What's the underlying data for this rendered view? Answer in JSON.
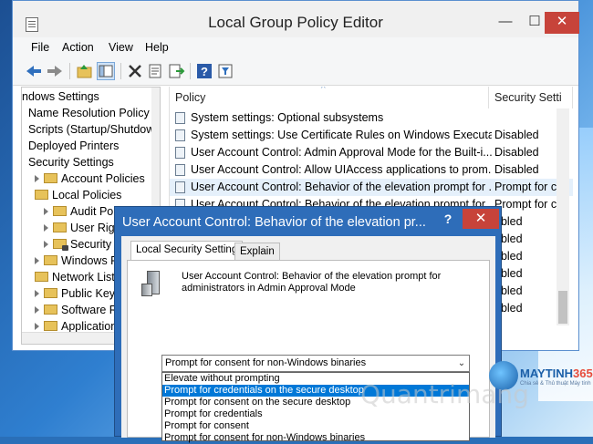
{
  "window": {
    "title": "Local Group Policy Editor",
    "min_glyph": "—",
    "max_glyph": "☐",
    "close_glyph": "✕"
  },
  "menu": [
    "File",
    "Action",
    "View",
    "Help"
  ],
  "toolbar_icons": [
    "back-arrow-icon",
    "forward-arrow-icon",
    "up-folder-icon",
    "show-tree-icon",
    "delete-icon",
    "properties-icon",
    "export-icon",
    "help-icon",
    "filter-icon"
  ],
  "tree": {
    "items": [
      {
        "label": "ndows Settings",
        "indent": 0,
        "icon": "none"
      },
      {
        "label": "Name Resolution Policy",
        "indent": 1,
        "icon": "none"
      },
      {
        "label": "Scripts (Startup/Shutdow",
        "indent": 1,
        "icon": "none"
      },
      {
        "label": "Deployed Printers",
        "indent": 1,
        "icon": "none",
        "arrow": true
      },
      {
        "label": "Security Settings",
        "indent": 1,
        "icon": "none"
      },
      {
        "label": "Account Policies",
        "indent": 2,
        "icon": "folder",
        "arrow": true
      },
      {
        "label": "Local Policies",
        "indent": 2,
        "icon": "folder"
      },
      {
        "label": "Audit Polic",
        "indent": 3,
        "icon": "folder",
        "arrow": true
      },
      {
        "label": "User Right",
        "indent": 3,
        "icon": "folder",
        "arrow": true
      },
      {
        "label": "Security O",
        "indent": 3,
        "icon": "lockfolder",
        "arrow": true
      },
      {
        "label": "Windows Firew",
        "indent": 2,
        "icon": "folder",
        "arrow": true
      },
      {
        "label": "Network List M",
        "indent": 2,
        "icon": "folder"
      },
      {
        "label": "Public Key Pol",
        "indent": 2,
        "icon": "folder",
        "arrow": true
      },
      {
        "label": "Software Restr",
        "indent": 2,
        "icon": "folder",
        "arrow": true
      },
      {
        "label": "Application Co",
        "indent": 2,
        "icon": "folder",
        "arrow": true
      }
    ]
  },
  "list": {
    "columns": [
      "Policy",
      "Security Setti"
    ],
    "sort_glyph": "^",
    "rows": [
      {
        "policy": "System settings: Optional subsystems",
        "setting": ""
      },
      {
        "policy": "System settings: Use Certificate Rules on Windows Executabl...",
        "setting": "Disabled"
      },
      {
        "policy": "User Account Control: Admin Approval Mode for the Built-i...",
        "setting": "Disabled"
      },
      {
        "policy": "User Account Control: Allow UIAccess applications to prom...",
        "setting": "Disabled"
      },
      {
        "policy": "User Account Control: Behavior of the elevation prompt for ...",
        "setting": "Prompt for c",
        "selected": true
      },
      {
        "policy": "User Account Control: Behavior of the elevation prompt for ...",
        "setting": "Prompt for c"
      },
      {
        "policy": "",
        "setting": "abled"
      },
      {
        "policy": "",
        "setting": "abled"
      },
      {
        "policy": "",
        "setting": "abled"
      },
      {
        "policy": "",
        "setting": "abled"
      },
      {
        "policy": "",
        "setting": "abled"
      },
      {
        "policy": "",
        "setting": "abled"
      }
    ]
  },
  "dialog": {
    "title": "User Account Control: Behavior of the elevation pr...",
    "help_glyph": "?",
    "close_glyph": "✕",
    "tabs": [
      "Local Security Setting",
      "Explain"
    ],
    "description": "User Account Control: Behavior of the elevation prompt for administrators in Admin Approval Mode",
    "selected_value": "Prompt for consent for non-Windows binaries",
    "dropdown_glyph": "⌄",
    "options": [
      "Elevate without prompting",
      "Prompt for credentials on the secure desktop",
      "Prompt for consent on the secure desktop",
      "Prompt for credentials",
      "Prompt for consent",
      "Prompt for consent for non-Windows binaries"
    ],
    "highlighted_index": 1
  },
  "watermark": {
    "brand_a": "MAYTINH",
    "brand_b": "365",
    "tagline": "Chia sẻ & Thủ thuật Máy tính",
    "overlay": "Quantrimang"
  }
}
